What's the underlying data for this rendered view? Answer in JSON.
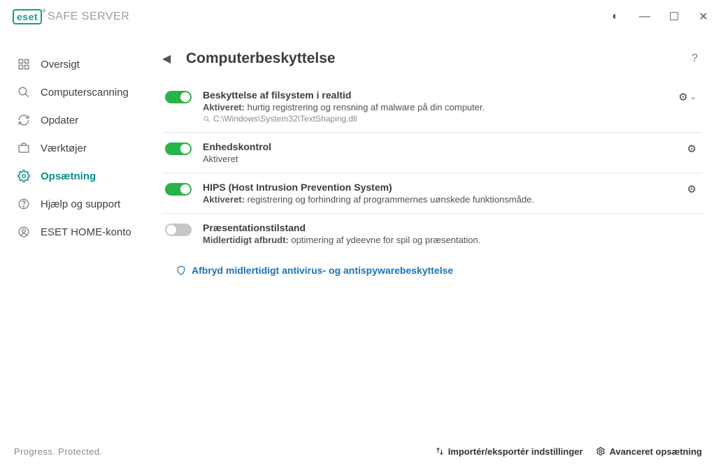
{
  "product": {
    "brand": "eset",
    "name": "SAFE SERVER"
  },
  "sidebar": {
    "items": [
      {
        "label": "Oversigt"
      },
      {
        "label": "Computerscanning"
      },
      {
        "label": "Opdater"
      },
      {
        "label": "Værktøjer"
      },
      {
        "label": "Opsætning"
      },
      {
        "label": "Hjælp og support"
      },
      {
        "label": "ESET HOME-konto"
      }
    ]
  },
  "page": {
    "title": "Computerbeskyttelse"
  },
  "rows": {
    "realtime": {
      "title": "Beskyttelse af filsystem i realtid",
      "status": "Aktiveret:",
      "desc": "hurtig registrering og rensning af malware på din computer.",
      "path": "C:\\Windows\\System32\\TextShaping.dll"
    },
    "device": {
      "title": "Enhedskontrol",
      "status": "Aktiveret"
    },
    "hips": {
      "title": "HIPS (Host Intrusion Prevention System)",
      "status": "Aktiveret:",
      "desc": "registrering og forhindring af programmernes uønskede funktionsmåde."
    },
    "presentation": {
      "title": "Præsentationstilstand",
      "status": "Midlertidigt afbrudt:",
      "desc": "optimering af ydeevne for spil og præsentation."
    }
  },
  "pause_link": "Afbryd midlertidigt antivirus- og antispywarebeskyttelse",
  "footer": {
    "slogan": "Progress. Protected.",
    "import_export": "Importér/eksportér indstillinger",
    "advanced": "Avanceret opsætning"
  }
}
